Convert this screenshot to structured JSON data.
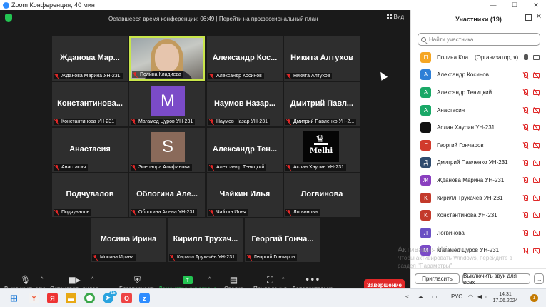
{
  "window": {
    "title": "Zoom Конференция, 40 мин",
    "minimize": "—",
    "maximize": "☐",
    "close": "✕"
  },
  "topbar": {
    "notice": "Оставшееся время конференции: 06:49 | Перейти на профессиональный план",
    "view_label": "Вид"
  },
  "tiles": [
    {
      "name": "Жданова Мар...",
      "label": "Жданова Марина УН-231"
    },
    {
      "name": "",
      "label": "Полина Кладиева",
      "type": "video"
    },
    {
      "name": "Александр Кос...",
      "label": "Александр Косинов"
    },
    {
      "name": "Никита Алтухов",
      "label": "Никита Алтухов"
    },
    {
      "name": "Константинова...",
      "label": "Константинова УН-231"
    },
    {
      "name": "M",
      "label": "Магамед Цуров УН-231",
      "type": "avatar-m"
    },
    {
      "name": "Наумов Назар...",
      "label": "Наумов Назар УН-231"
    },
    {
      "name": "Дмитрий Павл...",
      "label": "Дмитрий Павленко УН-2..."
    },
    {
      "name": "Анастасия",
      "label": "Анастасия"
    },
    {
      "name": "S",
      "label": "Элеонора Алифанова",
      "type": "avatar-s"
    },
    {
      "name": "Александр Тен...",
      "label": "Александр Теницкий"
    },
    {
      "name": "Melhi",
      "label": "Аслан Хаурин УН-231",
      "type": "logo"
    },
    {
      "name": "Подчувалов",
      "label": "Подчувалов"
    },
    {
      "name": "Облогина Але...",
      "label": "Облогина Алена УН-231"
    },
    {
      "name": "Чайкин Илья",
      "label": "Чайкин Илья"
    },
    {
      "name": "Логвинова",
      "label": "Логвинова"
    },
    {
      "name": "Мосина Ирина",
      "label": "Мосина Ирина"
    },
    {
      "name": "Кирилл Трухач...",
      "label": "Кирилл Трухачёв УН-231"
    },
    {
      "name": "Георгий Гонча...",
      "label": "Георгий Гончаров"
    }
  ],
  "toolbar": {
    "mute": "Выключить звук",
    "video": "Остановить видео",
    "security": "Безопасность",
    "share": "Демонстрация экрана",
    "summary": "Сводка",
    "apps": "Приложения",
    "more": "Дополнительно",
    "end": "Завершение"
  },
  "panel": {
    "title": "Участники (19)",
    "search_placeholder": "Найти участника",
    "invite": "Пригласить",
    "mute_all": "Выключить звук для всех",
    "more": "..."
  },
  "participants": [
    {
      "initial": "П",
      "name": "Полина Кла...",
      "note": "(Организатор, я)",
      "color": "#f5a623",
      "mic": "on",
      "cam": "on"
    },
    {
      "initial": "А",
      "name": "Александр Косинов",
      "color": "#2e7fd6",
      "mic": "off",
      "cam": "off"
    },
    {
      "initial": "А",
      "name": "Александр Теницкий",
      "color": "#1aa867",
      "mic": "off",
      "cam": "off"
    },
    {
      "initial": "А",
      "name": "Анастасия",
      "color": "#1aa867",
      "mic": "off",
      "cam": "off"
    },
    {
      "initial": "",
      "name": "Аслан Хаурин УН-231",
      "color": "#111111",
      "mic": "off",
      "cam": "off"
    },
    {
      "initial": "Г",
      "name": "Георгий Гончаров",
      "color": "#d13a2c",
      "mic": "off",
      "cam": "off"
    },
    {
      "initial": "Д",
      "name": "Дмитрий Павленко УН-231",
      "color": "#2f4b6e",
      "mic": "off",
      "cam": "off"
    },
    {
      "initial": "Ж",
      "name": "Жданова Марина УН-231",
      "color": "#8a3fbf",
      "mic": "off",
      "cam": "off"
    },
    {
      "initial": "К",
      "name": "Кирилл Трухачёв УН-231",
      "color": "#c33a2b",
      "mic": "off",
      "cam": "off"
    },
    {
      "initial": "К",
      "name": "Константинова УН-231",
      "color": "#c33a2b",
      "mic": "off",
      "cam": "off"
    },
    {
      "initial": "Л",
      "name": "Логвинова",
      "color": "#6a4fc4",
      "mic": "off",
      "cam": "off"
    },
    {
      "initial": "М",
      "name": "Магамед Цуров УН-231",
      "color": "#7b4bc8",
      "mic": "off",
      "cam": "off"
    }
  ],
  "watermark": {
    "line1": "Активация Windows",
    "line2": "Чтобы активировать Windows, перейдите в",
    "line3": "раздел \"Параметры\"."
  },
  "taskbar": {
    "lang": "РУС",
    "time": "14:31",
    "date": "17.06.2024",
    "notifications": "1",
    "badge": "15"
  }
}
